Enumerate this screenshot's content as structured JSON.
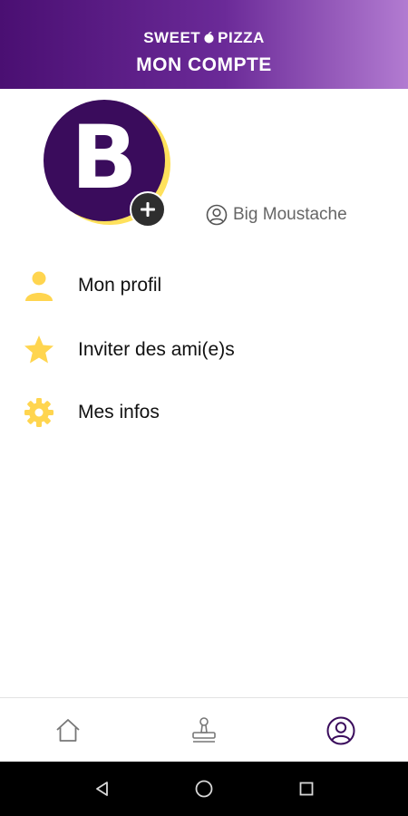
{
  "header": {
    "brand_left": "SWEET",
    "brand_right": "PIZZA",
    "title": "MON COMPTE",
    "brand_icon": "apple-icon"
  },
  "profile": {
    "avatar_letter": "B",
    "add_photo_icon": "plus-icon",
    "user_icon": "user-circle-icon",
    "username": "Big Moustache"
  },
  "menu": {
    "items": [
      {
        "label": "Mon profil",
        "icon": "person-icon"
      },
      {
        "label": "Inviter des ami(e)s",
        "icon": "star-icon"
      },
      {
        "label": "Mes infos",
        "icon": "gear-icon"
      }
    ]
  },
  "bottom_nav": {
    "items": [
      {
        "icon": "home-icon",
        "active": false
      },
      {
        "icon": "stamp-icon",
        "active": false
      },
      {
        "icon": "account-icon",
        "active": true
      }
    ]
  },
  "colors": {
    "brand_purple": "#3a0c5c",
    "accent_yellow": "#ffd54f",
    "header_gradient_start": "#4a0f72",
    "header_gradient_end": "#b27bd1"
  }
}
